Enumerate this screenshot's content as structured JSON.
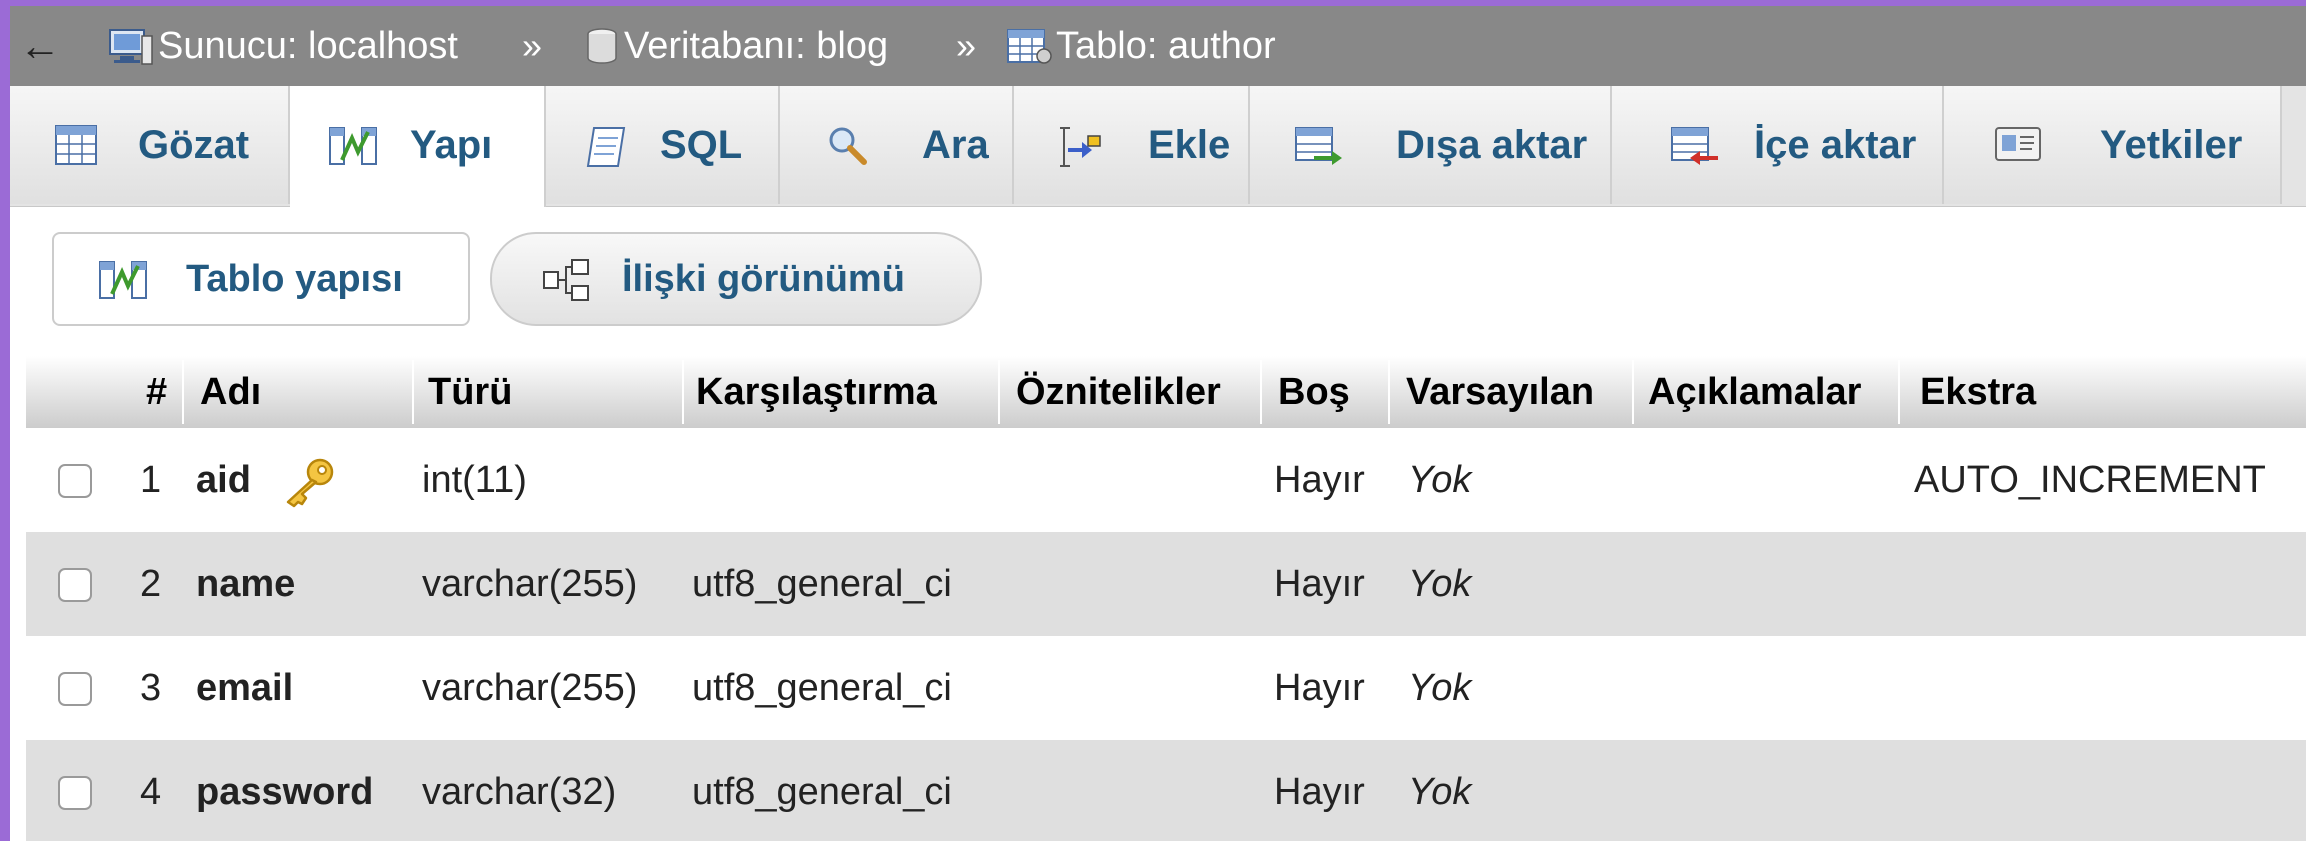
{
  "breadcrumb": {
    "back_label": "←",
    "server": "Sunucu: localhost",
    "database": "Veritabanı: blog",
    "table": "Tablo: author",
    "separator": "»"
  },
  "tabs": [
    {
      "label": "Gözat",
      "icon": "browse-icon"
    },
    {
      "label": "Yapı",
      "icon": "structure-icon",
      "active": true
    },
    {
      "label": "SQL",
      "icon": "sql-icon"
    },
    {
      "label": "Ara",
      "icon": "search-icon"
    },
    {
      "label": "Ekle",
      "icon": "insert-icon"
    },
    {
      "label": "Dışa aktar",
      "icon": "export-icon"
    },
    {
      "label": "İçe aktar",
      "icon": "import-icon"
    },
    {
      "label": "Yetkiler",
      "icon": "privileges-icon"
    }
  ],
  "subnav": {
    "structure_label": "Tablo yapısı",
    "relation_label": "İlişki görünümü"
  },
  "table": {
    "headers": [
      "#",
      "Adı",
      "Türü",
      "Karşılaştırma",
      "Öznitelikler",
      "Boş",
      "Varsayılan",
      "Açıklamalar",
      "Ekstra"
    ],
    "rows": [
      {
        "num": "1",
        "name": "aid",
        "type": "int(11)",
        "collation": "",
        "attributes": "",
        "null": "Hayır",
        "default": "Yok",
        "comments": "",
        "extra": "AUTO_INCREMENT",
        "primary_key": true
      },
      {
        "num": "2",
        "name": "name",
        "type": "varchar(255)",
        "collation": "utf8_general_ci",
        "attributes": "",
        "null": "Hayır",
        "default": "Yok",
        "comments": "",
        "extra": ""
      },
      {
        "num": "3",
        "name": "email",
        "type": "varchar(255)",
        "collation": "utf8_general_ci",
        "attributes": "",
        "null": "Hayır",
        "default": "Yok",
        "comments": "",
        "extra": ""
      },
      {
        "num": "4",
        "name": "password",
        "type": "varchar(32)",
        "collation": "utf8_general_ci",
        "attributes": "",
        "null": "Hayır",
        "default": "Yok",
        "comments": "",
        "extra": ""
      }
    ]
  },
  "colors": {
    "breadcrumb_bg": "#888888",
    "tab_text": "#235a81",
    "accent": "#9b6bd6",
    "row_alt": "#dfdfdf"
  }
}
